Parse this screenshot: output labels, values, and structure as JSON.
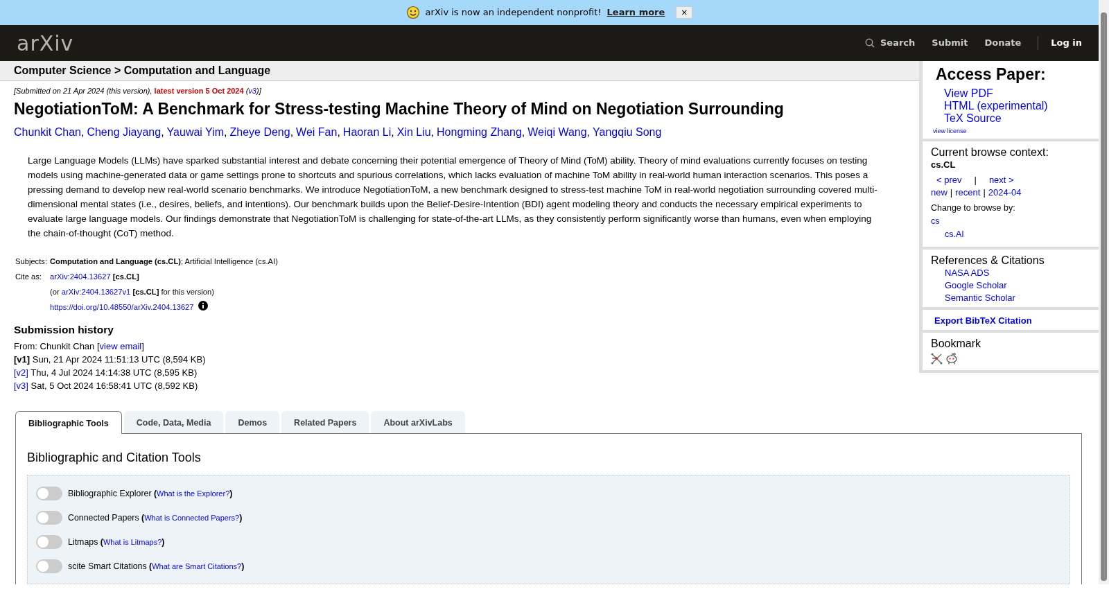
{
  "banner": {
    "text": "arXiv is now an independent nonprofit!",
    "link": "Learn more",
    "close": "×"
  },
  "nav": {
    "logo": "arXiv",
    "search": "Search",
    "items": [
      "Submit",
      "Donate"
    ],
    "login": "Log in"
  },
  "breadcrumb": "Computer Science > Computation and Language",
  "dateline": {
    "before": "[Submitted on 21 Apr 2024 (this version), ",
    "latest": "latest version 5 Oct 2024",
    "middle": " (",
    "version": "v3",
    "after": ")]"
  },
  "title": "NegotiationToM: A Benchmark for Stress-testing Machine Theory of Mind on Negotiation Surrounding",
  "authors": [
    {
      "name": "Chunkit Chan",
      "sep": ","
    },
    {
      "name": "Cheng Jiayang",
      "sep": ","
    },
    {
      "name": "Yauwai Yim",
      "sep": ","
    },
    {
      "name": "Zheye Deng",
      "sep": ","
    },
    {
      "name": "Wei Fan",
      "sep": ","
    },
    {
      "name": "Haoran Li",
      "sep": ","
    },
    {
      "name": "Xin Liu",
      "sep": ","
    },
    {
      "name": "Hongming Zhang",
      "sep": ","
    },
    {
      "name": "Weiqi Wang",
      "sep": ","
    },
    {
      "name": "Yangqiu Song"
    }
  ],
  "abstract": "Large Language Models (LLMs) have sparked substantial interest and debate concerning their potential emergence of Theory of Mind (ToM) ability. Theory of mind evaluations currently focuses on testing models using machine-generated data or game settings prone to shortcuts and spurious correlations, which lacks evaluation of machine ToM ability in real-world human interaction scenarios. This poses a pressing demand to develop new real-world scenario benchmarks. We introduce NegotiationToM, a new benchmark designed to stress-test machine ToM in real-world negotiation surrounding covered multi-dimensional mental states (i.e., desires, beliefs, and intentions). Our benchmark builds upon the Belief-Desire-Intention (BDI) agent modeling theory and conducts the necessary empirical experiments to evaluate large language models. Our findings demonstrate that NegotiationToM is challenging for state-of-the-art LLMs, as they consistently perform significantly worse than humans, even when employing the chain-of-thought (CoT) method.",
  "metadata": {
    "subjects_label": "Subjects:",
    "subjects": "**Computation and Language (cs.CL)**; Artificial Intelligence (cs.AI)",
    "cite_label": "Cite as:",
    "cite_id": "arXiv:2404.13627",
    "cite_tag": "[cs.CL]",
    "version_before": "(or ",
    "version_id": "arXiv:2404.13627v1",
    "version_after": " **[cs.CL]** for this version)",
    "doi": "https://doi.org/10.48550/arXiv.2404.13627"
  },
  "history": {
    "heading": "Submission history",
    "from": "From: Chunkit Chan [",
    "email": "view email",
    "from_end": "]",
    "versions": [
      {
        "label": "[v1]",
        "current": true,
        "text": " Sun, 21 Apr 2024 11:51:13 UTC (8,594 KB)"
      },
      {
        "label": "[v2]",
        "current": false,
        "text": " Thu, 4 Jul 2024 14:14:38 UTC (8,595 KB)"
      },
      {
        "label": "[v3]",
        "current": false,
        "text": " Sat, 5 Oct 2024 16:58:41 UTC (8,592 KB)"
      }
    ]
  },
  "sidebar": {
    "access_heading": "Access Paper:",
    "access_links": [
      "View PDF",
      "HTML (experimental)",
      "TeX Source"
    ],
    "license": "view license",
    "context_heading": "Current browse context:",
    "context": "cs.CL",
    "prev": "< prev",
    "sep": "|",
    "next": "next >",
    "browse_links": [
      {
        "text": "new",
        "sep": "|"
      },
      {
        "text": "recent",
        "sep": "|"
      },
      {
        "text": "2024-04"
      }
    ],
    "change_label": "Change to browse by:",
    "change_links": [
      {
        "text": "cs",
        "children": [
          {
            "text": "cs.AI"
          }
        ]
      }
    ],
    "refs_heading": "References & Citations",
    "refs": [
      "NASA ADS",
      "Google Scholar",
      "Semantic Scholar"
    ],
    "export": "Export BibTeX Citation",
    "bookmark_heading": "Bookmark"
  },
  "tabs": [
    {
      "label": "Bibliographic Tools",
      "selected": true
    },
    {
      "label": "Code, Data, Media",
      "selected": false
    },
    {
      "label": "Demos",
      "selected": false
    },
    {
      "label": "Related Papers",
      "selected": false
    },
    {
      "label": "About arXivLabs",
      "selected": false
    }
  ],
  "tools": {
    "heading": "Bibliographic and Citation Tools",
    "items": [
      {
        "label": "Bibliographic Explorer **(**",
        "help": "What is the Explorer?",
        "close": "**)**",
        "on": false
      },
      {
        "label": "Connected Papers **(**",
        "help": "What is Connected Papers?",
        "close": "**)**",
        "on": false
      },
      {
        "label": "Litmaps **(**",
        "help": "What is Litmaps?",
        "close": "**)**",
        "on": false
      },
      {
        "label": "scite Smart Citations **(**",
        "help": "What are Smart Citations?",
        "close": "**)**",
        "on": false
      }
    ]
  }
}
